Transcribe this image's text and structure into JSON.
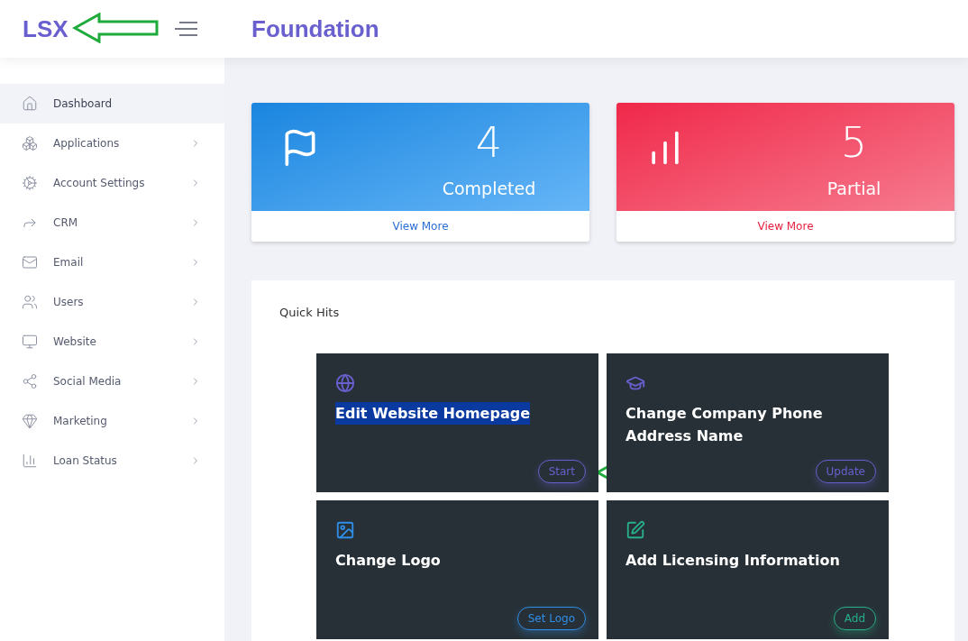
{
  "brand": "LSX",
  "page_title": "Foundation",
  "sidebar": {
    "items": [
      {
        "label": "Dashboard",
        "selected": true,
        "has_submenu": false
      },
      {
        "label": "Applications",
        "selected": false,
        "has_submenu": true
      },
      {
        "label": "Account Settings",
        "selected": false,
        "has_submenu": true
      },
      {
        "label": "CRM",
        "selected": false,
        "has_submenu": true
      },
      {
        "label": "Email",
        "selected": false,
        "has_submenu": true
      },
      {
        "label": "Users",
        "selected": false,
        "has_submenu": true
      },
      {
        "label": "Website",
        "selected": false,
        "has_submenu": true
      },
      {
        "label": "Social Media",
        "selected": false,
        "has_submenu": true
      },
      {
        "label": "Marketing",
        "selected": false,
        "has_submenu": true
      },
      {
        "label": "Loan Status",
        "selected": false,
        "has_submenu": true
      }
    ]
  },
  "stats": [
    {
      "kind": "blue",
      "value": "4",
      "label": "Completed",
      "link": "View More"
    },
    {
      "kind": "red",
      "value": "5",
      "label": "Partial",
      "link": "View More"
    }
  ],
  "quick_hits": {
    "title": "Quick Hits",
    "tiles": [
      {
        "color": "#6a5fcf",
        "title": "Edit Website Homepage",
        "text_selected": true,
        "button": "Start"
      },
      {
        "color": "#6a5fcf",
        "title": "Change Company Phone Address Name",
        "text_selected": false,
        "button": "Update"
      },
      {
        "color": "#2f8fe8",
        "title": "Change Logo",
        "text_selected": false,
        "button": "Set Logo"
      },
      {
        "color": "#27b08a",
        "title": "Add Licensing Information",
        "text_selected": false,
        "button": "Add"
      }
    ]
  }
}
